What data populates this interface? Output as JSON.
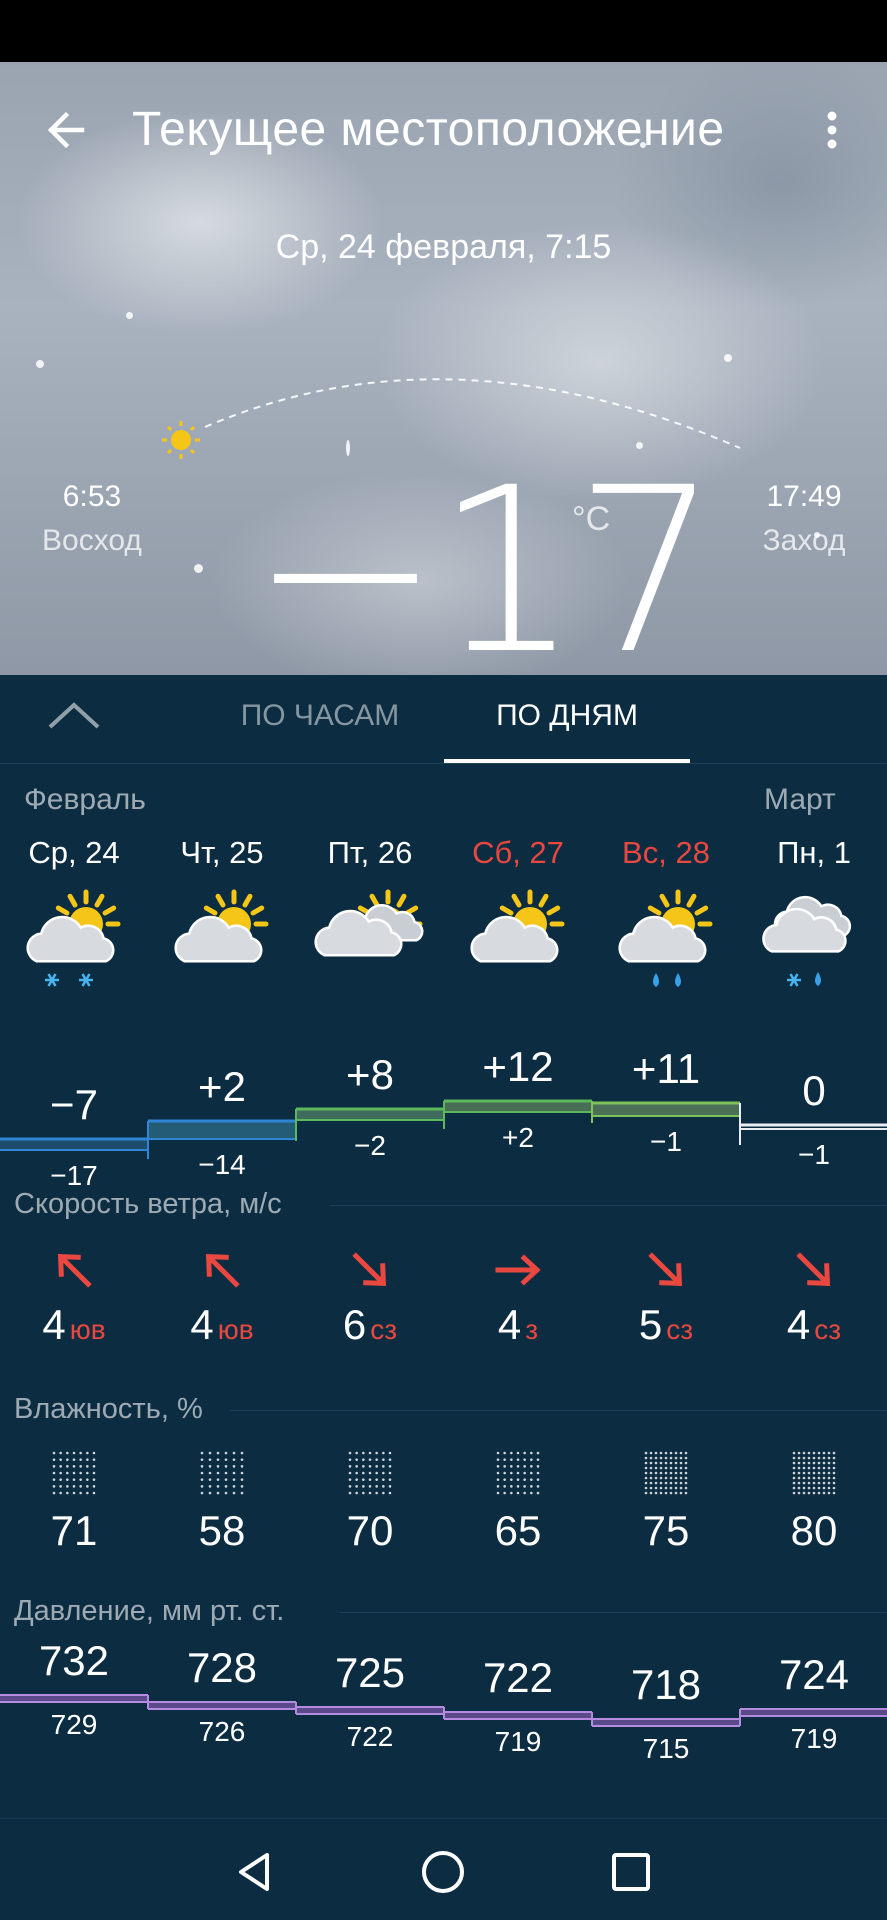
{
  "header": {
    "title": "Текущее местоположение",
    "datetime": "Ср, 24 февраля, 7:15"
  },
  "sun": {
    "sunrise_time": "6:53",
    "sunrise_label": "Восход",
    "sunset_time": "17:49",
    "sunset_label": "Заход"
  },
  "current": {
    "temperature": "−17",
    "unit": "°C"
  },
  "tabs": {
    "hourly": "ПО ЧАСАМ",
    "daily": "ПО ДНЯМ"
  },
  "months": {
    "first": "Февраль",
    "second": "Март"
  },
  "days": [
    {
      "label": "Ср, 24",
      "weekend": false,
      "icon": "partly-cloudy-snow-icon",
      "high": "−7",
      "low": "−17",
      "wind_speed": "4",
      "wind_dir": "юв",
      "wind_arrow": "arrow-up-left-icon",
      "humidity": "71",
      "pressure_high": "732",
      "pressure_low": "729"
    },
    {
      "label": "Чт, 25",
      "weekend": false,
      "icon": "partly-cloudy-icon",
      "high": "+2",
      "low": "−14",
      "wind_speed": "4",
      "wind_dir": "юв",
      "wind_arrow": "arrow-up-left-icon",
      "humidity": "58",
      "pressure_high": "728",
      "pressure_low": "726"
    },
    {
      "label": "Пт, 26",
      "weekend": false,
      "icon": "mostly-cloudy-icon",
      "high": "+8",
      "low": "−2",
      "wind_speed": "6",
      "wind_dir": "сз",
      "wind_arrow": "arrow-down-right-icon",
      "humidity": "70",
      "pressure_high": "725",
      "pressure_low": "722"
    },
    {
      "label": "Сб, 27",
      "weekend": true,
      "icon": "partly-cloudy-icon",
      "high": "+12",
      "low": "+2",
      "wind_speed": "4",
      "wind_dir": "з",
      "wind_arrow": "arrow-right-icon",
      "humidity": "65",
      "pressure_high": "722",
      "pressure_low": "719"
    },
    {
      "label": "Вс, 28",
      "weekend": true,
      "icon": "partly-cloudy-rain-icon",
      "high": "+11",
      "low": "−1",
      "wind_speed": "5",
      "wind_dir": "сз",
      "wind_arrow": "arrow-down-right-icon",
      "humidity": "75",
      "pressure_high": "718",
      "pressure_low": "715"
    },
    {
      "label": "Пн, 1",
      "weekend": false,
      "icon": "cloudy-sleet-icon",
      "high": "0",
      "low": "−1",
      "wind_speed": "4",
      "wind_dir": "сз",
      "wind_arrow": "arrow-down-right-icon",
      "humidity": "80",
      "pressure_high": "724",
      "pressure_low": "719"
    }
  ],
  "sections": {
    "wind": "Скорость ветра, м/с",
    "humidity": "Влажность, %",
    "pressure": "Давление, мм рт. ст."
  },
  "colors": {
    "panel": "#0c2c41",
    "weekend": "#e8483f",
    "wind_arrow": "#e8483f",
    "sun": "#f5c518",
    "precip_snow": "#49b4f0",
    "precip_rain": "#3aa0e8",
    "pressure_line": "#b48be0"
  },
  "chart_data": [
    {
      "type": "line",
      "categories": [
        "Ср, 24",
        "Чт, 25",
        "Пт, 26",
        "Сб, 27",
        "Вс, 28",
        "Пн, 1"
      ],
      "series": [],
      "x": [
        "Ср, 24",
        "Чт, 25",
        "Пт, 26",
        "Сб, 27",
        "Вс, 28",
        "Пн, 1"
      ],
      "high": [
        -7,
        2,
        8,
        12,
        11,
        0
      ],
      "low": [
        -17,
        -14,
        -2,
        2,
        -1,
        -1
      ]
    },
    {
      "type": "line",
      "categories": [
        "Ср, 24",
        "Чт, 25",
        "Пт, 26",
        "Сб, 27",
        "Вс, 28",
        "Пн, 1"
      ],
      "series": [],
      "high": [
        732,
        728,
        725,
        722,
        718,
        724
      ],
      "low": [
        729,
        726,
        722,
        719,
        715,
        719
      ]
    }
  ]
}
